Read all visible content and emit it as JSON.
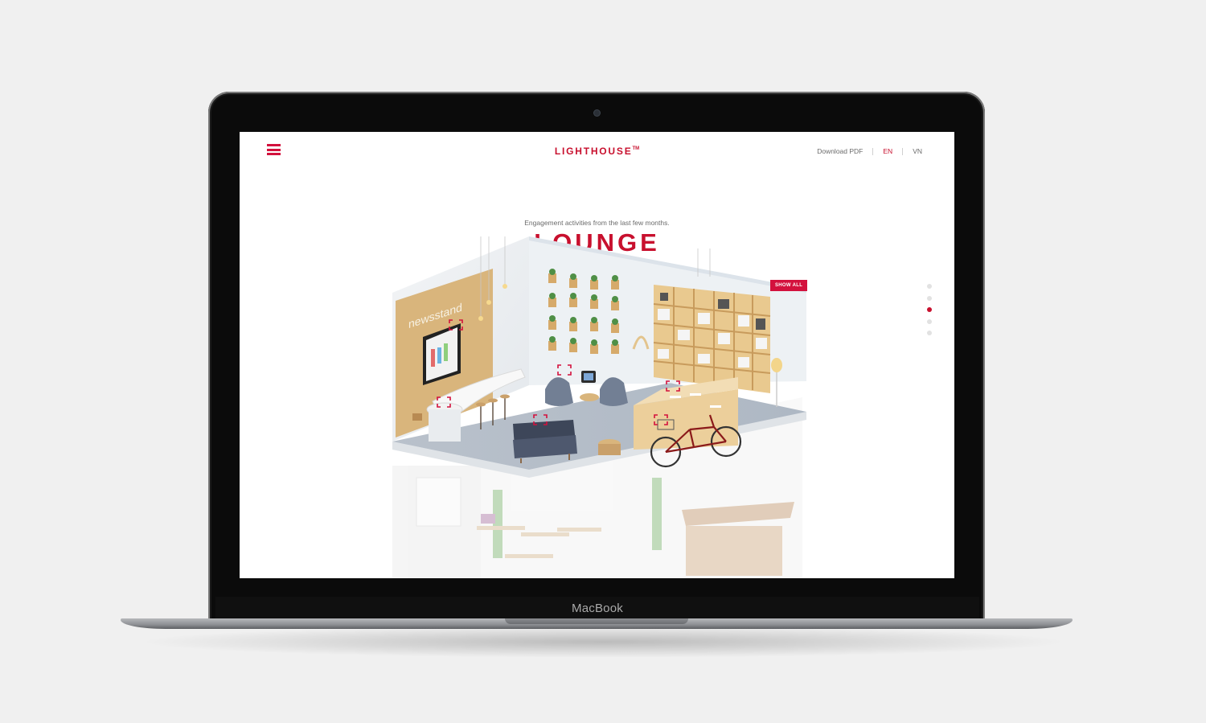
{
  "device": {
    "brand": "MacBook"
  },
  "header": {
    "menu_icon": "hamburger-menu-icon",
    "logo": "LIGHTHOUSE",
    "logo_mark": "TM",
    "nav": {
      "download": "Download PDF",
      "lang_en": "EN",
      "lang_vn": "VN",
      "active_language": "EN"
    }
  },
  "hero": {
    "subtitle": "Engagement activities from the last few months.",
    "title": "LOUNGE",
    "show_all": "SHOW ALL",
    "wall_sign": "newsstand"
  },
  "pagination": {
    "total": 5,
    "active_index": 2
  },
  "colors": {
    "accent": "#c8102e",
    "text_muted": "#6b6b6b",
    "background": "#ffffff"
  }
}
